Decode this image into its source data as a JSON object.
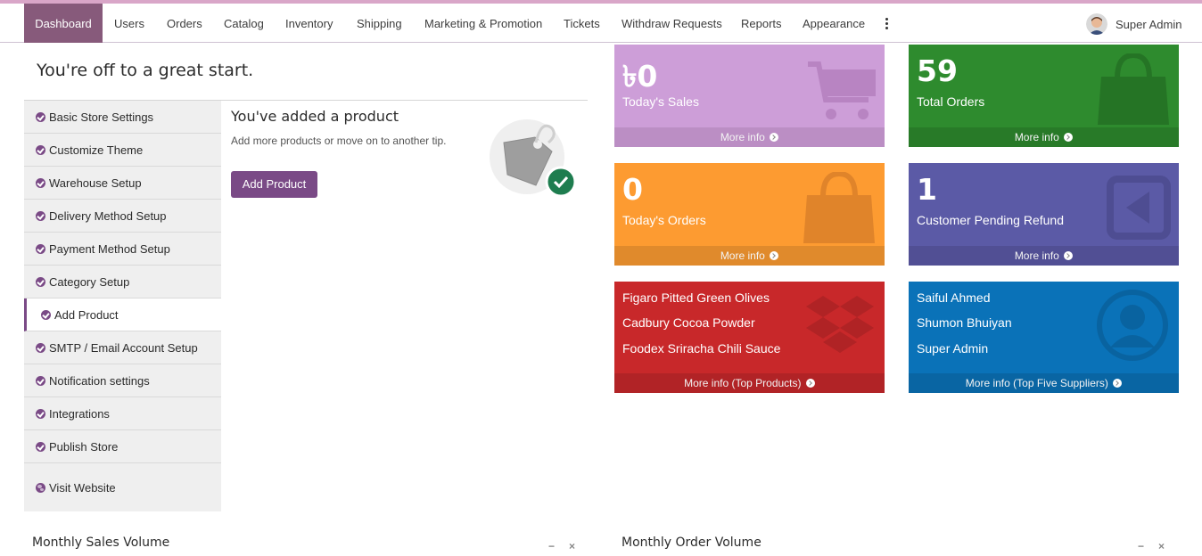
{
  "nav": {
    "items": [
      {
        "label": "Dashboard",
        "active": true
      },
      {
        "label": "Users"
      },
      {
        "label": "Orders"
      },
      {
        "label": "Catalog"
      },
      {
        "label": "Inventory"
      },
      {
        "label": "Shipping"
      },
      {
        "label": "Marketing & Promotion"
      },
      {
        "label": "Tickets"
      },
      {
        "label": "Withdraw Requests"
      },
      {
        "label": "Reports"
      },
      {
        "label": "Appearance"
      }
    ],
    "more_icon": "kebab-vertical-icon",
    "user_name": "Super Admin"
  },
  "welcome": "You're off to a great start.",
  "steps": [
    {
      "label": "Basic Store Settings",
      "icon": "check-circle-icon"
    },
    {
      "label": "Customize Theme",
      "icon": "check-circle-icon"
    },
    {
      "label": "Warehouse Setup",
      "icon": "check-circle-icon"
    },
    {
      "label": "Delivery Method Setup",
      "icon": "check-circle-icon"
    },
    {
      "label": "Payment Method Setup",
      "icon": "check-circle-icon"
    },
    {
      "label": "Category Setup",
      "icon": "check-circle-icon"
    },
    {
      "label": "Add Product",
      "icon": "check-circle-icon",
      "active": true
    },
    {
      "label": "SMTP / Email Account Setup",
      "icon": "check-circle-icon"
    },
    {
      "label": "Notification settings",
      "icon": "check-circle-icon"
    },
    {
      "label": "Integrations",
      "icon": "check-circle-icon"
    },
    {
      "label": "Publish Store",
      "icon": "check-circle-icon"
    },
    {
      "label": "Visit Website",
      "icon": "globe-icon"
    }
  ],
  "tip": {
    "title": "You've added a product",
    "text": "Add more products or move on to another tip.",
    "button": "Add Product"
  },
  "cards": {
    "sales": {
      "value": "৳0",
      "label": "Today's Sales",
      "footer": "More info",
      "color": "#cd9ed8",
      "footer_color": "#bb8ec4"
    },
    "total_orders": {
      "value": "59",
      "label": "Total Orders",
      "footer": "More info",
      "color": "#2e8b2e",
      "footer_color": "#287a28"
    },
    "today_orders": {
      "value": "0",
      "label": "Today's Orders",
      "footer": "More info",
      "color": "#fd9b31",
      "footer_color": "#e08a2c"
    },
    "pending_refund": {
      "value": "1",
      "label": "Customer Pending Refund",
      "footer": "More info",
      "color": "#5b5aa6",
      "footer_color": "#514f94"
    },
    "top_products": {
      "items": [
        "Figaro Pitted Green Olives",
        "Cadbury Cocoa Powder",
        "Foodex Sriracha Chili Sauce"
      ],
      "footer": "More info (Top Products)",
      "color": "#c8282a",
      "footer_color": "#b12326"
    },
    "top_suppliers": {
      "items": [
        "Saiful Ahmed",
        "Shumon Bhuiyan",
        "Super Admin"
      ],
      "footer": "More info (Top Five Suppliers)",
      "color": "#0a72b8",
      "footer_color": "#0965a3"
    }
  },
  "panels": {
    "sales_volume": {
      "title": "Monthly Sales Volume",
      "minimize": "−",
      "close": "×"
    },
    "order_volume": {
      "title": "Monthly Order Volume",
      "minimize": "−",
      "close": "×"
    }
  }
}
